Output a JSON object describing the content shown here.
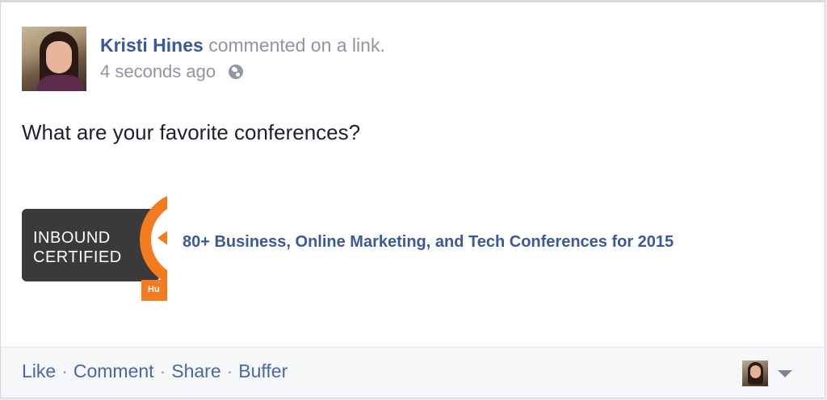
{
  "post": {
    "author": "Kristi Hines",
    "action_text": " commented on a link.",
    "timestamp": "4 seconds ago",
    "privacy_icon": "globe-icon",
    "status_text": "What are your favorite conferences?"
  },
  "link_preview": {
    "thumbnail_text": "INBOUND CERTIFIED",
    "thumbnail_tab_text": "Hu",
    "title": "80+ Business, Online Marketing, and Tech Conferences for 2015"
  },
  "footer": {
    "actions": [
      "Like",
      "Comment",
      "Share",
      "Buffer"
    ],
    "separator": "·",
    "caret_icon": "chevron-down-icon"
  },
  "colors": {
    "link_blue": "#3b5998",
    "meta_gray": "#90949c",
    "footer_bg": "#f6f7f9",
    "badge_orange": "#f47c20"
  }
}
